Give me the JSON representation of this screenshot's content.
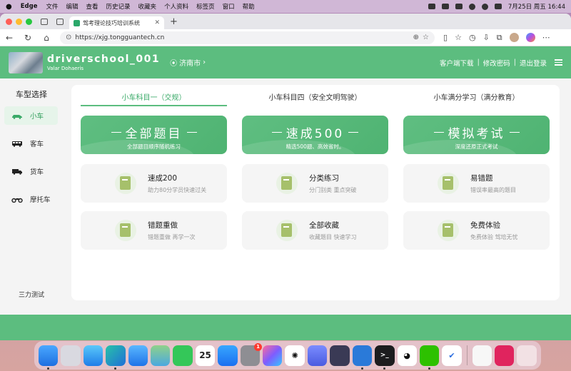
{
  "menubar": {
    "app": "Edge",
    "items": [
      "文件",
      "编辑",
      "查看",
      "历史记录",
      "收藏夹",
      "个人资料",
      "标签页",
      "窗口",
      "帮助"
    ],
    "datetime": "7月25日 周五 16:44"
  },
  "browser": {
    "tab_title": "驾考理论技巧培训系统",
    "url": "https://xjg.tongguantech.cn"
  },
  "header": {
    "brand": "driverschool_001",
    "sub": "Valar Dohaeris",
    "city": "济南市",
    "city_arrow": "›",
    "links": [
      "客户端下载",
      "修改密码",
      "退出登录"
    ],
    "sep": "|"
  },
  "sidebar": {
    "title": "车型选择",
    "items": [
      {
        "label": "小车",
        "icon": "car-icon"
      },
      {
        "label": "客车",
        "icon": "bus-icon"
      },
      {
        "label": "货车",
        "icon": "truck-icon"
      },
      {
        "label": "摩托车",
        "icon": "motorcycle-icon"
      }
    ],
    "bottom": "三力测试"
  },
  "tabs": [
    "小车科目一（交规）",
    "小车科目四（安全文明驾驶）",
    "小车满分学习（满分教育）"
  ],
  "big_cards": [
    {
      "title": "全部题目",
      "sub": "全部题目顺序随机练习"
    },
    {
      "title": "速成500",
      "sub": "精选500题、高效省时。"
    },
    {
      "title": "模拟考试",
      "sub": "深度还原正式考试"
    }
  ],
  "small_cards": [
    {
      "title": "速成200",
      "sub": "助力80分学员快速过关"
    },
    {
      "title": "分类练习",
      "sub": "分门别类 重点突破"
    },
    {
      "title": "易错题",
      "sub": "错误率最高的题目"
    },
    {
      "title": "错题重做",
      "sub": "错题重做 再学一次"
    },
    {
      "title": "全部收藏",
      "sub": "收藏题目 快速学习"
    },
    {
      "title": "免费体验",
      "sub": "免费体验 驾培无忧"
    }
  ],
  "dock": {
    "calendar_day": "25",
    "settings_badge": "1"
  },
  "colors": {
    "accent": "#5cbd7f",
    "icon_green": "#a6c06b"
  }
}
